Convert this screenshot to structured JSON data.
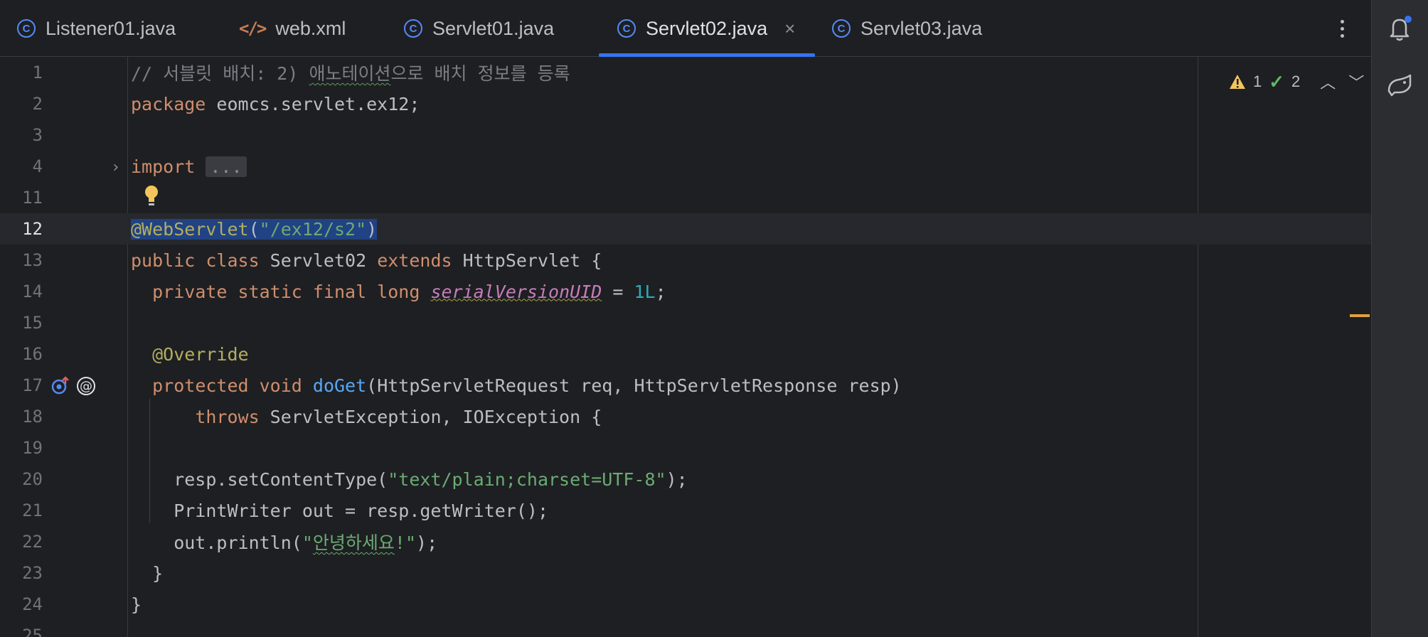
{
  "tabs": [
    {
      "label": "Listener01.java",
      "icon": "class-icon"
    },
    {
      "label": "web.xml",
      "icon": "xml-icon"
    },
    {
      "label": "Servlet01.java",
      "icon": "class-icon"
    },
    {
      "label": "Servlet02.java",
      "icon": "class-icon",
      "active": true
    },
    {
      "label": "Servlet03.java",
      "icon": "class-icon"
    }
  ],
  "inspections": {
    "warnings": "1",
    "ok": "2"
  },
  "lines": [
    {
      "num": "1",
      "text": "// 서블릿 배치: 2) 애노테이션으로 배치 정보를 등록"
    },
    {
      "num": "2",
      "text": "package eomcs.servlet.ex12;"
    },
    {
      "num": "3",
      "text": ""
    },
    {
      "num": "4",
      "text": "import ..."
    },
    {
      "num": "11",
      "text": ""
    },
    {
      "num": "12",
      "text": "@WebServlet(\"/ex12/s2\")"
    },
    {
      "num": "13",
      "text": "public class Servlet02 extends HttpServlet {"
    },
    {
      "num": "14",
      "text": "  private static final long serialVersionUID = 1L;"
    },
    {
      "num": "15",
      "text": ""
    },
    {
      "num": "16",
      "text": "  @Override"
    },
    {
      "num": "17",
      "text": "  protected void doGet(HttpServletRequest req, HttpServletResponse resp)"
    },
    {
      "num": "18",
      "text": "      throws ServletException, IOException {"
    },
    {
      "num": "19",
      "text": ""
    },
    {
      "num": "20",
      "text": "    resp.setContentType(\"text/plain;charset=UTF-8\");"
    },
    {
      "num": "21",
      "text": "    PrintWriter out = resp.getWriter();"
    },
    {
      "num": "22",
      "text": "    out.println(\"안녕하세요!\");"
    },
    {
      "num": "23",
      "text": "  }"
    },
    {
      "num": "24",
      "text": "}"
    },
    {
      "num": "25",
      "text": ""
    }
  ],
  "colors": {
    "accent": "#3574f0",
    "keyword": "#cf8e6d",
    "string": "#6aab73",
    "comment": "#7a7e85",
    "number": "#2aacb8",
    "annotation": "#b3ae60",
    "function": "#56a8f5"
  }
}
